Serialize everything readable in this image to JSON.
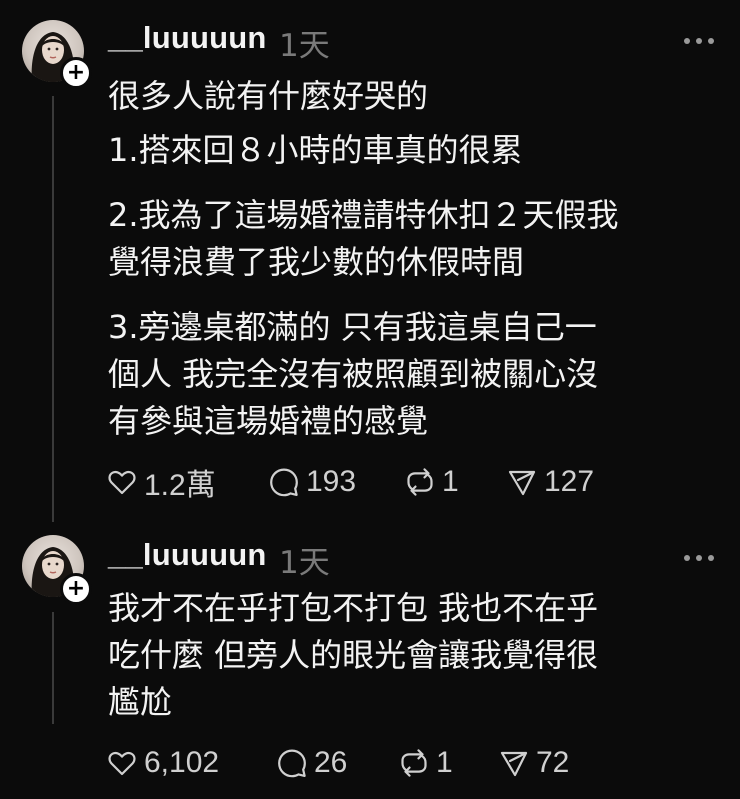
{
  "posts": [
    {
      "username": "__luuuuun",
      "time": "1天",
      "follow_symbol": "+",
      "paragraphs": [
        "很多人說有什麼好哭的",
        "1.搭來回８小時的車真的很累",
        "2.我為了這場婚禮請特休扣２天假我",
        "覺得浪費了我少數的休假時間",
        "3.旁邊桌都滿的 只有我這桌自己一",
        "個人 我完全沒有被照顧到被關心沒",
        "有參與這場婚禮的感覺"
      ],
      "likes": "1.2萬",
      "replies": "193",
      "reposts": "1",
      "shares": "127"
    },
    {
      "username": "__luuuuun",
      "time": "1天",
      "follow_symbol": "+",
      "paragraphs": [
        "我才不在乎打包不打包 我也不在乎",
        "吃什麼 但旁人的眼光會讓我覺得很",
        "尷尬"
      ],
      "likes": "6,102",
      "replies": "26",
      "reposts": "1",
      "shares": "72"
    }
  ],
  "icons": {
    "like": "heart-icon",
    "reply": "comment-bubble-icon",
    "repost": "repost-arrows-icon",
    "share": "send-paper-plane-icon",
    "more": "more-options-icon"
  },
  "colors": {
    "background": "#0b0b0b",
    "text": "#f3f3f3",
    "muted": "#7a7a7a",
    "thread_line": "#3a3a3a"
  }
}
